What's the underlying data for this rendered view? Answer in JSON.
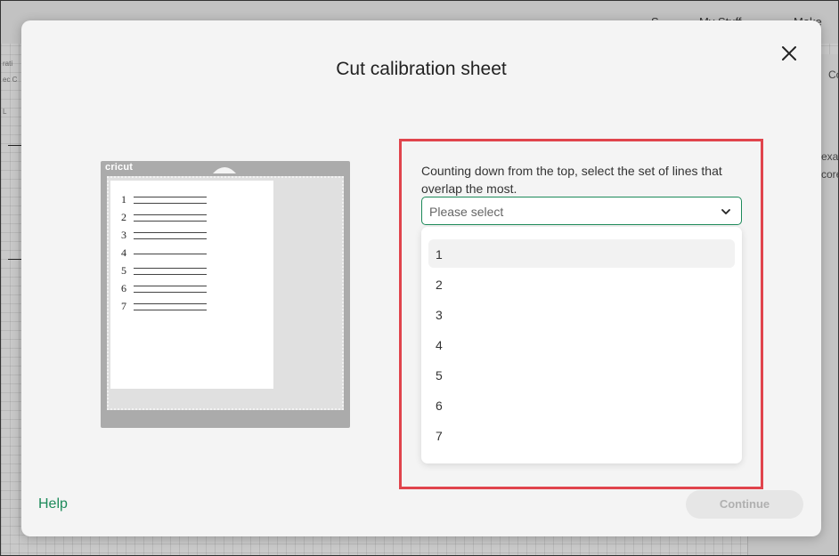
{
  "background": {
    "topbar_items": [
      "S",
      "My Stuff",
      "Make"
    ],
    "right_panel_texts": [
      "Co",
      "exag",
      "core"
    ],
    "left_texts": [
      "rati",
      "ec C",
      "L"
    ]
  },
  "modal": {
    "title": "Cut calibration sheet",
    "close_icon": "close-icon"
  },
  "mat": {
    "brand": "cricut",
    "calibration_rows": [
      "1",
      "2",
      "3",
      "4",
      "5",
      "6",
      "7"
    ]
  },
  "selection": {
    "question": "Counting down from the top, select the set of lines that overlap the most.",
    "placeholder": "Please select",
    "options": [
      "1",
      "2",
      "3",
      "4",
      "5",
      "6",
      "7"
    ],
    "highlighted_option": "1"
  },
  "footer": {
    "help_label": "Help",
    "continue_label": "Continue"
  },
  "colors": {
    "accent": "#1d8a5a",
    "highlight_border": "#e0444c",
    "modal_bg": "#f4f4f4"
  }
}
